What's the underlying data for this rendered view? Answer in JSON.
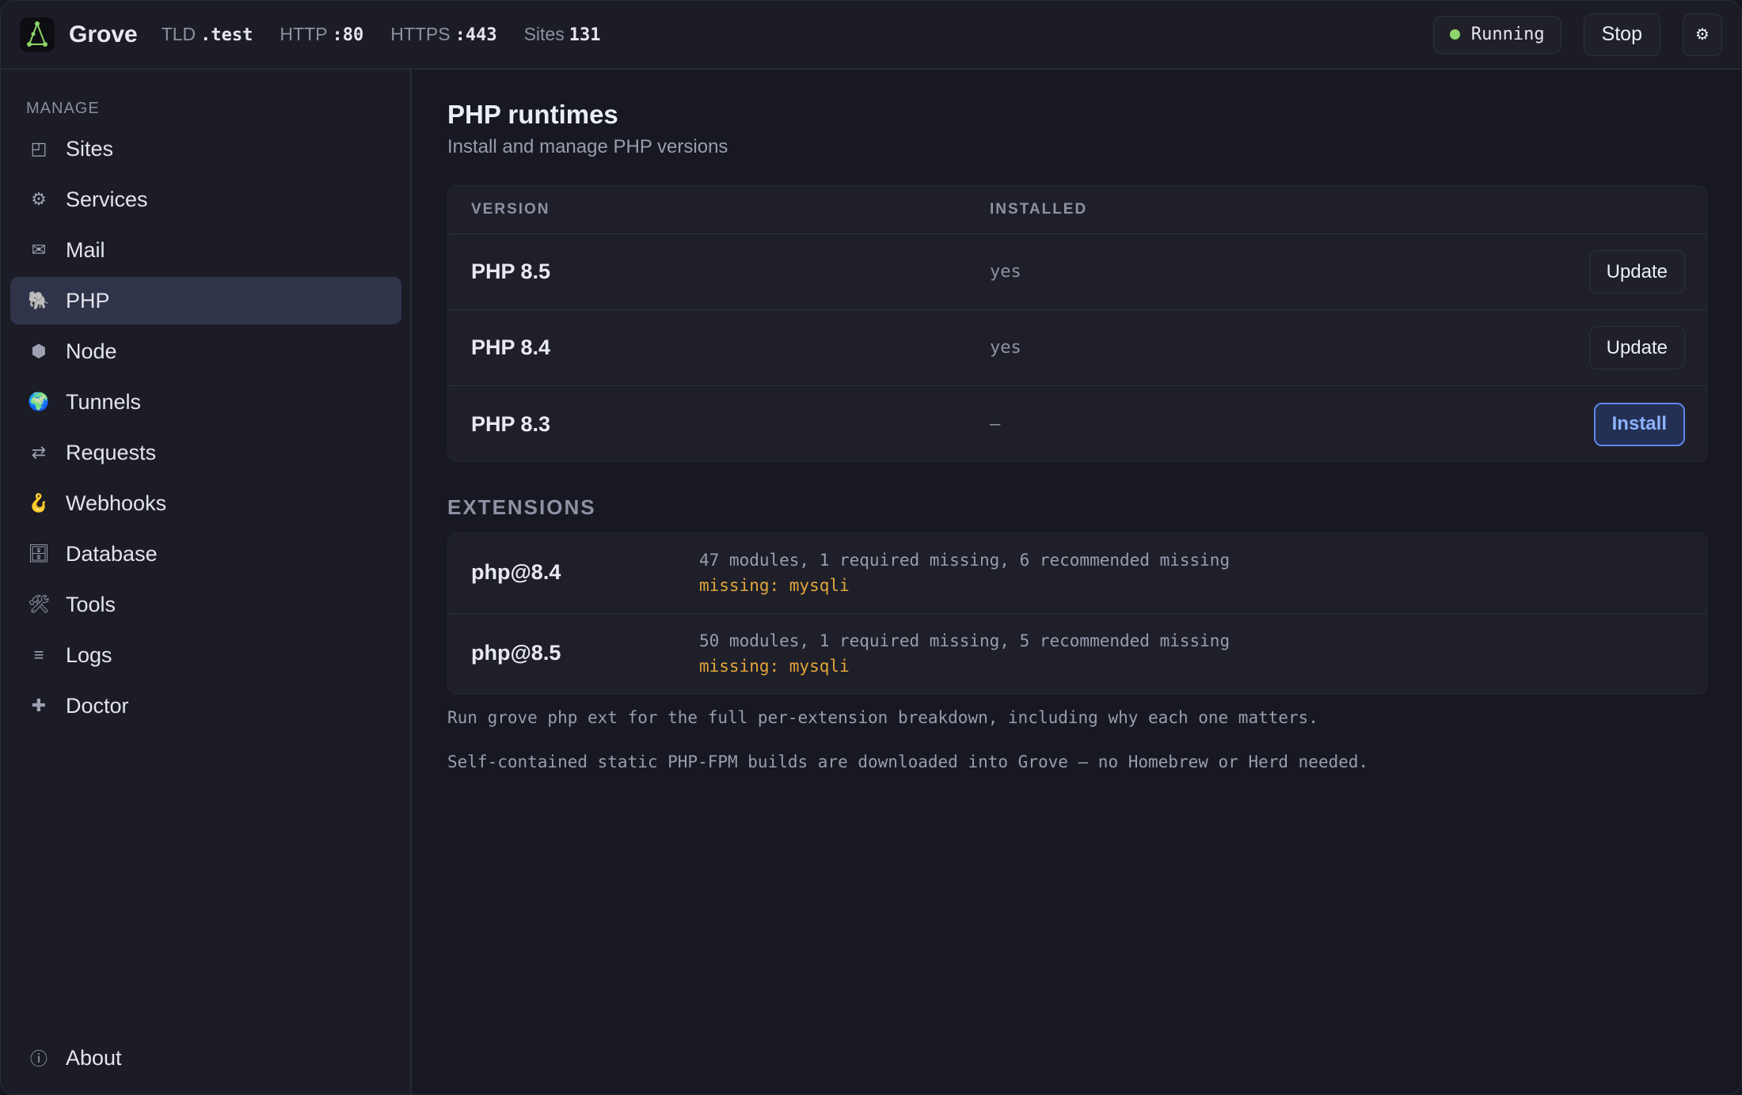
{
  "app": {
    "name": "Grove",
    "colors": {
      "accent": "#5f86e8",
      "running": "#8fd46a",
      "warning": "#e3a63a",
      "logo_green": "#8fd46a"
    }
  },
  "topbar": {
    "tld_label": "TLD",
    "tld_value": ".test",
    "http_label": "HTTP",
    "http_value": ":80",
    "https_label": "HTTPS",
    "https_value": ":443",
    "sites_label": "Sites",
    "sites_value": "131",
    "status": "Running",
    "stop_label": "Stop",
    "settings_icon": "⚙"
  },
  "sidebar": {
    "section": "MANAGE",
    "items": [
      {
        "icon": "◰",
        "label": "Sites"
      },
      {
        "icon": "⚙",
        "label": "Services"
      },
      {
        "icon": "✉",
        "label": "Mail"
      },
      {
        "icon": "🐘",
        "label": "PHP"
      },
      {
        "icon": "⬢",
        "label": "Node"
      },
      {
        "icon": "🌍",
        "label": "Tunnels"
      },
      {
        "icon": "⇄",
        "label": "Requests"
      },
      {
        "icon": "🪝",
        "label": "Webhooks"
      },
      {
        "icon": "🗄",
        "label": "Database"
      },
      {
        "icon": "🛠",
        "label": "Tools"
      },
      {
        "icon": "≡",
        "label": "Logs"
      },
      {
        "icon": "✚",
        "label": "Doctor"
      }
    ],
    "about": {
      "icon": "ⓘ",
      "label": "About"
    }
  },
  "main": {
    "title": "PHP runtimes",
    "subtitle": "Install and manage PHP versions",
    "runtimes": {
      "headers": {
        "version": "VERSION",
        "installed": "INSTALLED"
      },
      "rows": [
        {
          "version": "PHP 8.5",
          "installed": "yes",
          "action": "Update"
        },
        {
          "version": "PHP 8.4",
          "installed": "yes",
          "action": "Update"
        },
        {
          "version": "PHP 8.3",
          "installed": "–",
          "action": "Install"
        }
      ]
    },
    "extensions": {
      "title": "EXTENSIONS",
      "rows": [
        {
          "name": "php@8.4",
          "summary": "47 modules, 1 required missing, 6 recommended missing",
          "missing": "missing: mysqli"
        },
        {
          "name": "php@8.5",
          "summary": "50 modules, 1 required missing, 5 recommended missing",
          "missing": "missing: mysqli"
        }
      ]
    },
    "notes": [
      "Run grove php ext for the full per-extension breakdown, including why each one matters.",
      "Self-contained static PHP-FPM builds are downloaded into Grove — no Homebrew or Herd needed."
    ]
  }
}
